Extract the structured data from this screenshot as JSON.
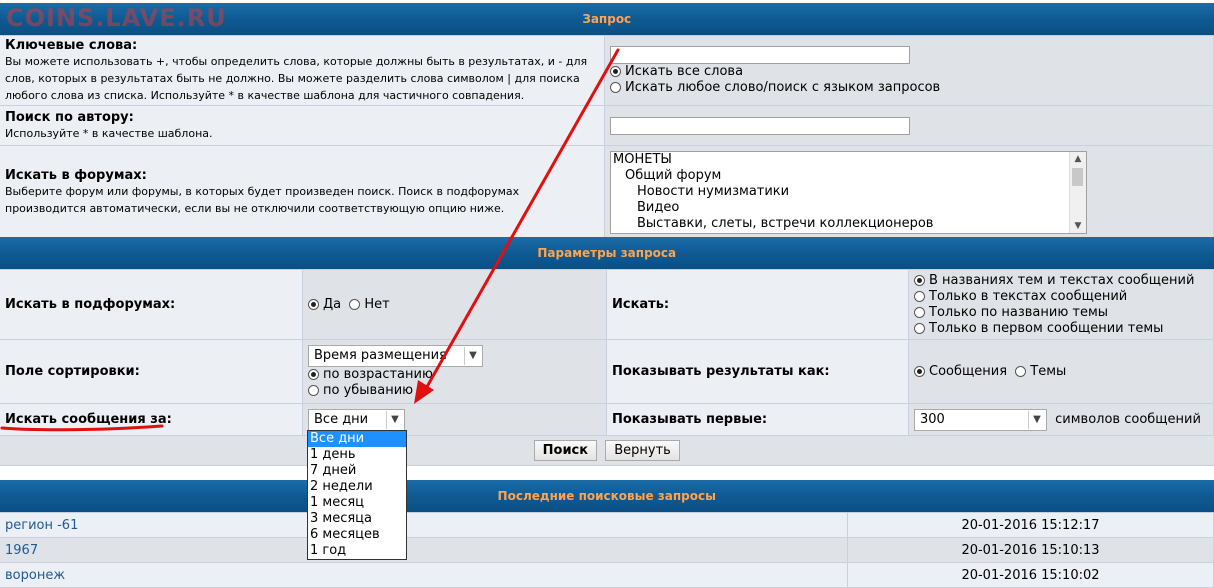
{
  "watermark": "COINS.LAVE.RU",
  "search_section": {
    "title": "Запрос",
    "keywords": {
      "label": "Ключевые слова:",
      "hint": "Вы можете использовать +, чтобы определить слова, которые должны быть в результатах, и - для слов, которых в результатах быть не должно. Вы можете разделить слова символом | для поиска любого слова из списка. Используйте * в качестве шаблона для частичного совпадения.",
      "value": "",
      "options": [
        "Искать все слова",
        "Искать любое слово/поиск с языком запросов"
      ],
      "selected": 0
    },
    "author": {
      "label": "Поиск по автору:",
      "hint": "Используйте * в качестве шаблона.",
      "value": ""
    },
    "forums": {
      "label": "Искать в форумах:",
      "hint": "Выберите форум или форумы, в которых будет произведен поиск. Поиск в подфорумах производится автоматически, если вы не отключили соответствующую опцию ниже.",
      "items": [
        "МОНЕТЫ",
        "Общий форум",
        "Новости нумизматики",
        "Видео",
        "Выставки, слеты, встречи коллекционеров"
      ]
    }
  },
  "params_section": {
    "title": "Параметры запроса",
    "subforums": {
      "label": "Искать в подфорумах:",
      "yes": "Да",
      "no": "Нет"
    },
    "search_in": {
      "label": "Искать:",
      "options": [
        "В названиях тем и текстах сообщений",
        "Только в текстах сообщений",
        "Только по названию темы",
        "Только в первом сообщении темы"
      ]
    },
    "sort": {
      "label": "Поле сортировки:",
      "value": "Время размещения",
      "asc": "по возрастанию",
      "desc": "по убыванию"
    },
    "display": {
      "label": "Показывать результаты как:",
      "posts": "Сообщения",
      "topics": "Темы"
    },
    "period": {
      "label": "Искать сообщения за:",
      "value": "Все дни"
    },
    "show_first": {
      "label": "Показывать первые:",
      "value": "300",
      "suffix": "символов сообщений"
    },
    "search_button": "Поиск",
    "reset_button": "Вернуть"
  },
  "period_dropdown": [
    "Все дни",
    "1 день",
    "7 дней",
    "2 недели",
    "1 месяц",
    "3 месяца",
    "6 месяцев",
    "1 год"
  ],
  "recent": {
    "title": "Последние поисковые запросы",
    "rows": [
      {
        "query": "регион -61",
        "time": "20-01-2016 15:12:17"
      },
      {
        "query": "1967",
        "time": "20-01-2016 15:10:13"
      },
      {
        "query": "воронеж",
        "time": "20-01-2016 15:10:02"
      }
    ]
  }
}
